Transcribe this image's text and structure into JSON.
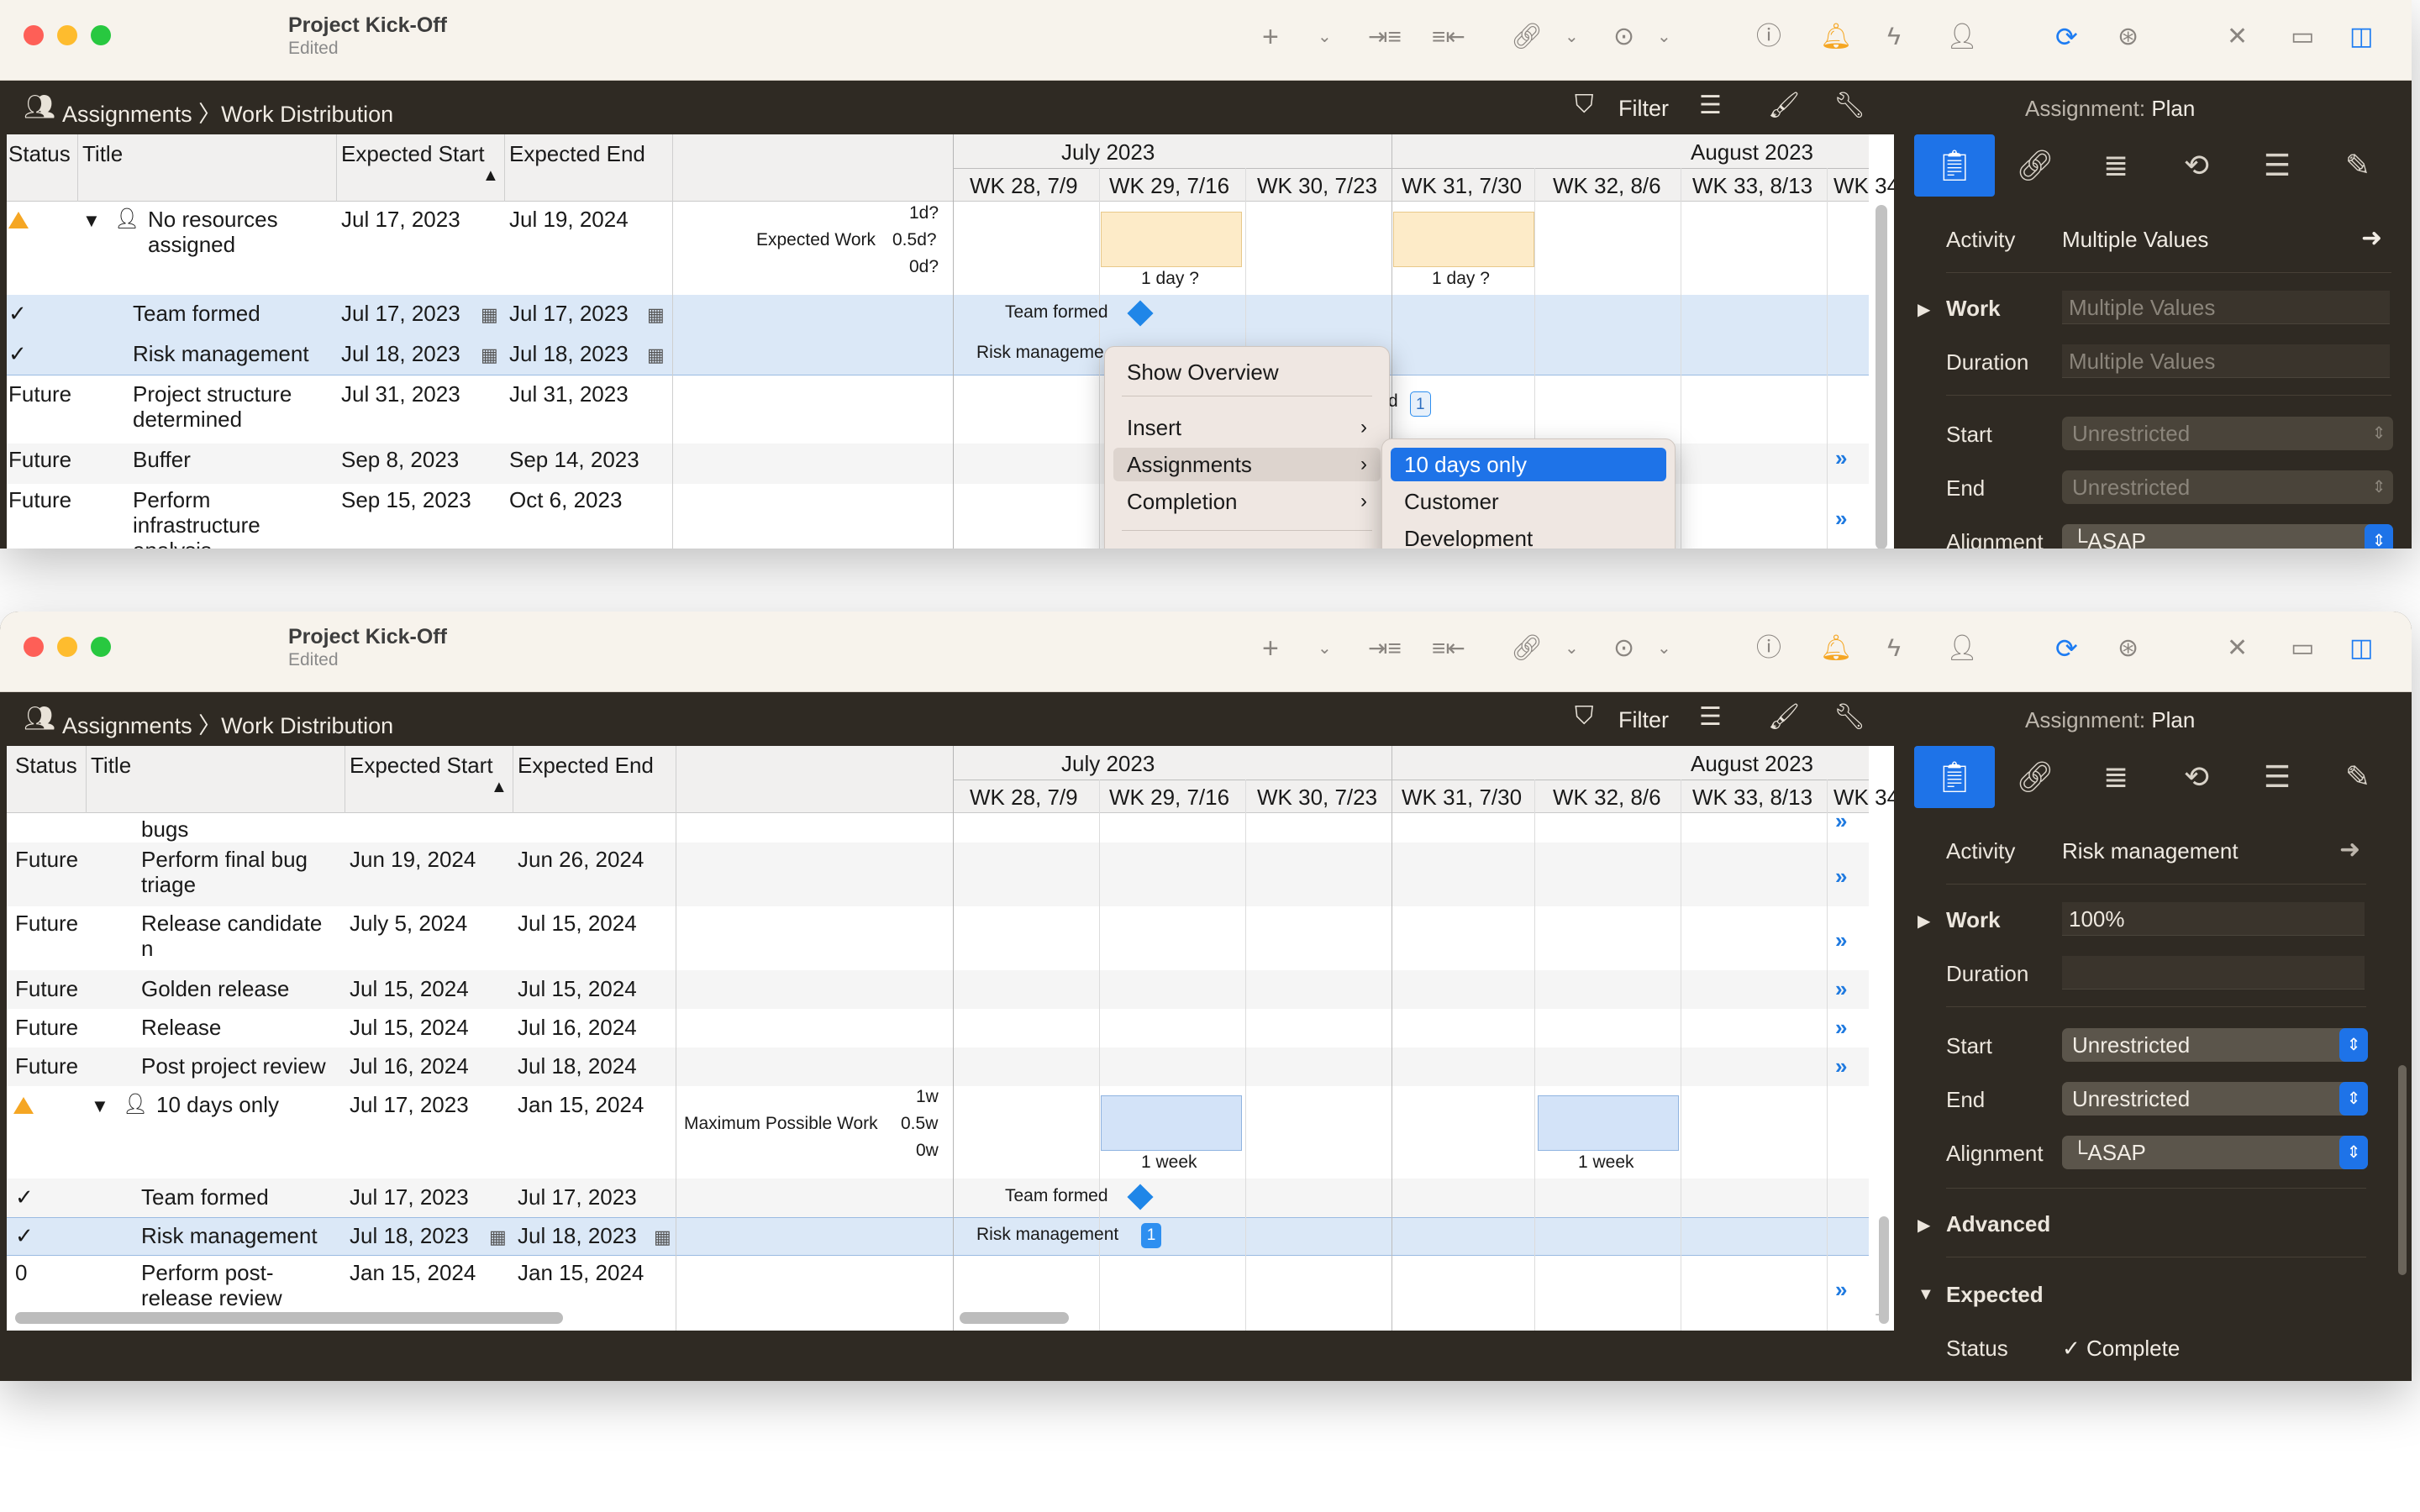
{
  "colors": {
    "accent": "#1e73e8",
    "warning": "#f5a623",
    "chrome_dark": "#2f2a23",
    "titlebar": "#f7f3ec"
  },
  "toolbar_icons": [
    "plus-icon",
    "chevron-down-icon",
    "indent-icon",
    "outdent-icon",
    "link-icon",
    "chevron-down-icon",
    "more-icon",
    "chevron-down-icon",
    "help-icon",
    "bell-icon",
    "bolt-icon",
    "person-icon",
    "sync-icon",
    "network-icon",
    "tools-icon",
    "bottom-panel-icon",
    "sidebar-icon"
  ],
  "windows": [
    {
      "doc_title": "Project Kick-Off",
      "doc_subtitle": "Edited",
      "breadcrumb": "Assignments 〉Work Distribution",
      "filter_label": "Filter",
      "inspector_header_prefix": "Assignment:",
      "inspector_header_value": "Plan",
      "columns": {
        "status": "Status",
        "title": "Title",
        "expected_start": "Expected Start",
        "expected_end": "Expected End"
      },
      "months": [
        "July 2023",
        "August 2023"
      ],
      "weeks": [
        "WK 28, 7/9",
        "WK 29, 7/16",
        "WK 30, 7/23",
        "WK 31, 7/30",
        "WK 32, 8/6",
        "WK 33, 8/13",
        "WK 34"
      ],
      "rows": [
        {
          "status": "",
          "title": "No resources assigned",
          "start": "Jul 17, 2023",
          "end": "Jul 19, 2024"
        },
        {
          "status": "✓",
          "title": "Team formed",
          "start": "Jul 17, 2023",
          "end": "Jul 17, 2023"
        },
        {
          "status": "✓",
          "title": "Risk management",
          "start": "Jul 18, 2023",
          "end": "Jul 18, 2023"
        },
        {
          "status": "Future",
          "title": "Project structure determined",
          "start": "Jul 31, 2023",
          "end": "Jul 31, 2023"
        },
        {
          "status": "Future",
          "title": "Buffer",
          "start": "Sep 8, 2023",
          "end": "Sep 14, 2023"
        },
        {
          "status": "Future",
          "title": "Perform infrastructure analysis",
          "start": "Sep 15, 2023",
          "end": "Oct 6, 2023"
        }
      ],
      "chart_axis": {
        "metric_label": "Expected Work",
        "ticks": [
          "1d?",
          "0.5d?",
          "0d?"
        ]
      },
      "bar_labels": [
        "1 day ?",
        "1 day ?"
      ],
      "gantt_labels": {
        "team_formed": "Team formed",
        "risk_management": "Risk manageme",
        "partial": "d",
        "badge": "1"
      },
      "context_menu": {
        "items": [
          "Show Overview",
          "Insert",
          "Assignments",
          "Completion"
        ],
        "submenu": [
          "10 days only",
          "Customer",
          "Development"
        ]
      },
      "inspector": {
        "activity_label": "Activity",
        "activity_value": "Multiple Values",
        "work_label": "Work",
        "work_value": "Multiple Values",
        "duration_label": "Duration",
        "duration_value": "Multiple Values",
        "start_label": "Start",
        "start_value": "Unrestricted",
        "end_label": "End",
        "end_value": "Unrestricted",
        "alignment_label": "Alignment",
        "alignment_value": "└ASAP"
      }
    },
    {
      "doc_title": "Project Kick-Off",
      "doc_subtitle": "Edited",
      "breadcrumb": "Assignments 〉Work Distribution",
      "filter_label": "Filter",
      "inspector_header_prefix": "Assignment:",
      "inspector_header_value": "Plan",
      "columns": {
        "status": "Status",
        "title": "Title",
        "expected_start": "Expected Start",
        "expected_end": "Expected End"
      },
      "months": [
        "July 2023",
        "August 2023"
      ],
      "weeks": [
        "WK 28, 7/9",
        "WK 29, 7/16",
        "WK 30, 7/23",
        "WK 31, 7/30",
        "WK 32, 8/6",
        "WK 33, 8/13",
        "WK 34"
      ],
      "rows": [
        {
          "status": "",
          "title": "bugs",
          "start": "",
          "end": ""
        },
        {
          "status": "Future",
          "title": "Perform final bug triage",
          "start": "Jun 19, 2024",
          "end": "Jun 26, 2024"
        },
        {
          "status": "Future",
          "title": "Release candidate n",
          "start": "July 5, 2024",
          "end": "Jul 15, 2024"
        },
        {
          "status": "Future",
          "title": "Golden release",
          "start": "Jul 15, 2024",
          "end": "Jul 15, 2024"
        },
        {
          "status": "Future",
          "title": "Release",
          "start": "Jul 15, 2024",
          "end": "Jul 16, 2024"
        },
        {
          "status": "Future",
          "title": "Post project review",
          "start": "Jul 16, 2024",
          "end": "Jul 18, 2024"
        },
        {
          "status": "",
          "title": "10 days only",
          "start": "Jul 17, 2023",
          "end": "Jan 15, 2024"
        },
        {
          "status": "✓",
          "title": "Team formed",
          "start": "Jul 17, 2023",
          "end": "Jul 17, 2023"
        },
        {
          "status": "✓",
          "title": "Risk management",
          "start": "Jul 18, 2023",
          "end": "Jul 18, 2023"
        },
        {
          "status": "0",
          "title": "Perform post-release review",
          "start": "Jan 15, 2024",
          "end": "Jan 15, 2024"
        }
      ],
      "chart_axis": {
        "metric_label": "Maximum Possible Work",
        "ticks": [
          "1w",
          "0.5w",
          "0w"
        ]
      },
      "bar_labels": [
        "1 week",
        "1 week"
      ],
      "gantt_labels": {
        "team_formed": "Team formed",
        "risk_management": "Risk management",
        "badge": "1"
      },
      "inspector": {
        "activity_label": "Activity",
        "activity_value": "Risk management",
        "work_label": "Work",
        "work_value": "100%",
        "duration_label": "Duration",
        "duration_value": "",
        "start_label": "Start",
        "start_value": "Unrestricted",
        "end_label": "End",
        "end_value": "Unrestricted",
        "alignment_label": "Alignment",
        "alignment_value": "└ASAP",
        "advanced_label": "Advanced",
        "expected_label": "Expected",
        "status_label": "Status",
        "status_value": "✓ Complete"
      }
    }
  ]
}
